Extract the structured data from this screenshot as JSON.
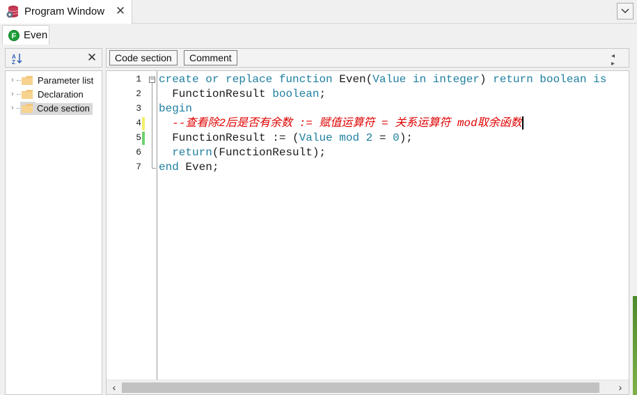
{
  "window": {
    "tab_title": "Program Window",
    "close_glyph": "✕",
    "dropdown_glyph": "⌄"
  },
  "object_tab": {
    "label": "Even",
    "type_icon_letter": "F"
  },
  "left_panel": {
    "close_glyph": "✕",
    "tree": [
      {
        "label": "Parameter list",
        "selected": false
      },
      {
        "label": "Declaration",
        "selected": false
      },
      {
        "label": "Code section",
        "selected": true
      }
    ]
  },
  "right_toolbar": {
    "buttons": [
      "Code section",
      "Comment"
    ],
    "nav": "◂ ▸"
  },
  "editor": {
    "line_numbers": [
      "1",
      "2",
      "3",
      "4",
      "5",
      "6",
      "7"
    ],
    "lines": [
      [
        {
          "t": "create or replace function ",
          "c": "kw"
        },
        {
          "t": "Even",
          "c": "id"
        },
        {
          "t": "(",
          "c": "pn"
        },
        {
          "t": "Value in integer",
          "c": "kw"
        },
        {
          "t": ") ",
          "c": "pn"
        },
        {
          "t": "return boolean is",
          "c": "kw"
        }
      ],
      [
        {
          "t": "  FunctionResult ",
          "c": "id"
        },
        {
          "t": "boolean",
          "c": "kw"
        },
        {
          "t": ";",
          "c": "pn"
        }
      ],
      [
        {
          "t": "begin",
          "c": "kw"
        }
      ],
      [
        {
          "t": "  --查看除2后是否有余数 := 赋值运算符 = 关系运算符 mod取余函数",
          "c": "cm"
        }
      ],
      [
        {
          "t": "  FunctionResult := (",
          "c": "id"
        },
        {
          "t": "Value mod 2",
          "c": "kw"
        },
        {
          "t": " = ",
          "c": "pn"
        },
        {
          "t": "0",
          "c": "kw"
        },
        {
          "t": ");",
          "c": "pn"
        }
      ],
      [
        {
          "t": "  ",
          "c": "pn"
        },
        {
          "t": "return",
          "c": "kw"
        },
        {
          "t": "(FunctionResult);",
          "c": "id"
        }
      ],
      [
        {
          "t": "end ",
          "c": "kw"
        },
        {
          "t": "Even;",
          "c": "id"
        }
      ]
    ],
    "change_markers": [
      {
        "line": 4,
        "color": "#f3f06a"
      },
      {
        "line": 5,
        "color": "#6fd36f"
      }
    ],
    "caret_line": 4,
    "scroll_left": "‹",
    "scroll_right": "›"
  }
}
